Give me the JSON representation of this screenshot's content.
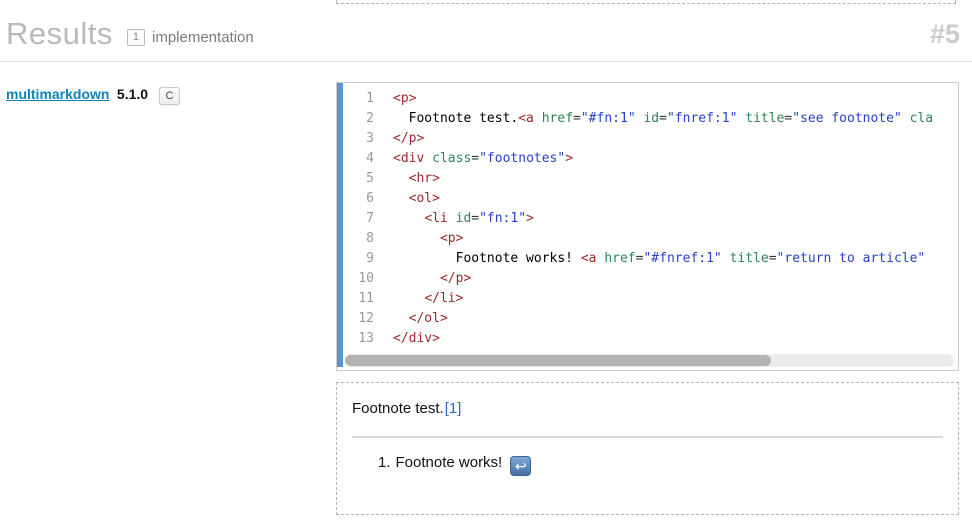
{
  "colors": {
    "accent_link": "#0d84b5",
    "footnote_link": "#3366cc",
    "tok_tag": "#a0282c",
    "tok_attr": "#2e8456",
    "tok_str": "#2742c8",
    "tok_pun": "#333333",
    "tok_text": "#000000",
    "gutter_accent": "#5b94ce",
    "line_number": "#999999",
    "icon_top": "#7fa7d9",
    "icon_bottom": "#47709f"
  },
  "header": {
    "title": "Results",
    "count_badge": "1",
    "subtitle": "implementation",
    "result_number": "#5"
  },
  "implementation": {
    "name": "multimarkdown",
    "version": "5.1.0",
    "lang_badge": "C"
  },
  "code": {
    "lines": [
      {
        "n": "1",
        "t": [
          [
            "tag",
            "<p>"
          ]
        ]
      },
      {
        "n": "2",
        "t": [
          [
            "text",
            "  Footnote test."
          ],
          [
            "tag",
            "<a"
          ],
          [
            "text",
            " "
          ],
          [
            "attr",
            "href"
          ],
          [
            "pun",
            "="
          ],
          [
            "str",
            "\"#fn:1\""
          ],
          [
            "text",
            " "
          ],
          [
            "attr",
            "id"
          ],
          [
            "pun",
            "="
          ],
          [
            "str",
            "\"fnref:1\""
          ],
          [
            "text",
            " "
          ],
          [
            "attr",
            "title"
          ],
          [
            "pun",
            "="
          ],
          [
            "str",
            "\"see footnote\""
          ],
          [
            "text",
            " "
          ],
          [
            "attr",
            "cla"
          ]
        ]
      },
      {
        "n": "3",
        "t": [
          [
            "tag",
            "</p>"
          ]
        ]
      },
      {
        "n": "4",
        "t": [
          [
            "tag",
            "<div"
          ],
          [
            "text",
            " "
          ],
          [
            "attr",
            "class"
          ],
          [
            "pun",
            "="
          ],
          [
            "str",
            "\"footnotes\""
          ],
          [
            "tag",
            ">"
          ]
        ]
      },
      {
        "n": "5",
        "t": [
          [
            "text",
            "  "
          ],
          [
            "tag",
            "<hr>"
          ]
        ]
      },
      {
        "n": "6",
        "t": [
          [
            "text",
            "  "
          ],
          [
            "tag",
            "<ol>"
          ]
        ]
      },
      {
        "n": "7",
        "t": [
          [
            "text",
            "    "
          ],
          [
            "tag",
            "<li"
          ],
          [
            "text",
            " "
          ],
          [
            "attr",
            "id"
          ],
          [
            "pun",
            "="
          ],
          [
            "str",
            "\"fn:1\""
          ],
          [
            "tag",
            ">"
          ]
        ]
      },
      {
        "n": "8",
        "t": [
          [
            "text",
            "      "
          ],
          [
            "tag",
            "<p>"
          ]
        ]
      },
      {
        "n": "9",
        "t": [
          [
            "text",
            "        Footnote works! "
          ],
          [
            "tag",
            "<a"
          ],
          [
            "text",
            " "
          ],
          [
            "attr",
            "href"
          ],
          [
            "pun",
            "="
          ],
          [
            "str",
            "\"#fnref:1\""
          ],
          [
            "text",
            " "
          ],
          [
            "attr",
            "title"
          ],
          [
            "pun",
            "="
          ],
          [
            "str",
            "\"return to article\""
          ]
        ]
      },
      {
        "n": "10",
        "t": [
          [
            "text",
            "      "
          ],
          [
            "tag",
            "</p>"
          ]
        ]
      },
      {
        "n": "11",
        "t": [
          [
            "text",
            "    "
          ],
          [
            "tag",
            "</li>"
          ]
        ]
      },
      {
        "n": "12",
        "t": [
          [
            "text",
            "  "
          ],
          [
            "tag",
            "</ol>"
          ]
        ]
      },
      {
        "n": "13",
        "t": [
          [
            "tag",
            "</div>"
          ]
        ]
      }
    ]
  },
  "preview": {
    "paragraph_text": "Footnote test.",
    "footnote_ref": "[1]",
    "list_marker": "1.",
    "list_text": "Footnote works!",
    "return_icon": "↩"
  }
}
